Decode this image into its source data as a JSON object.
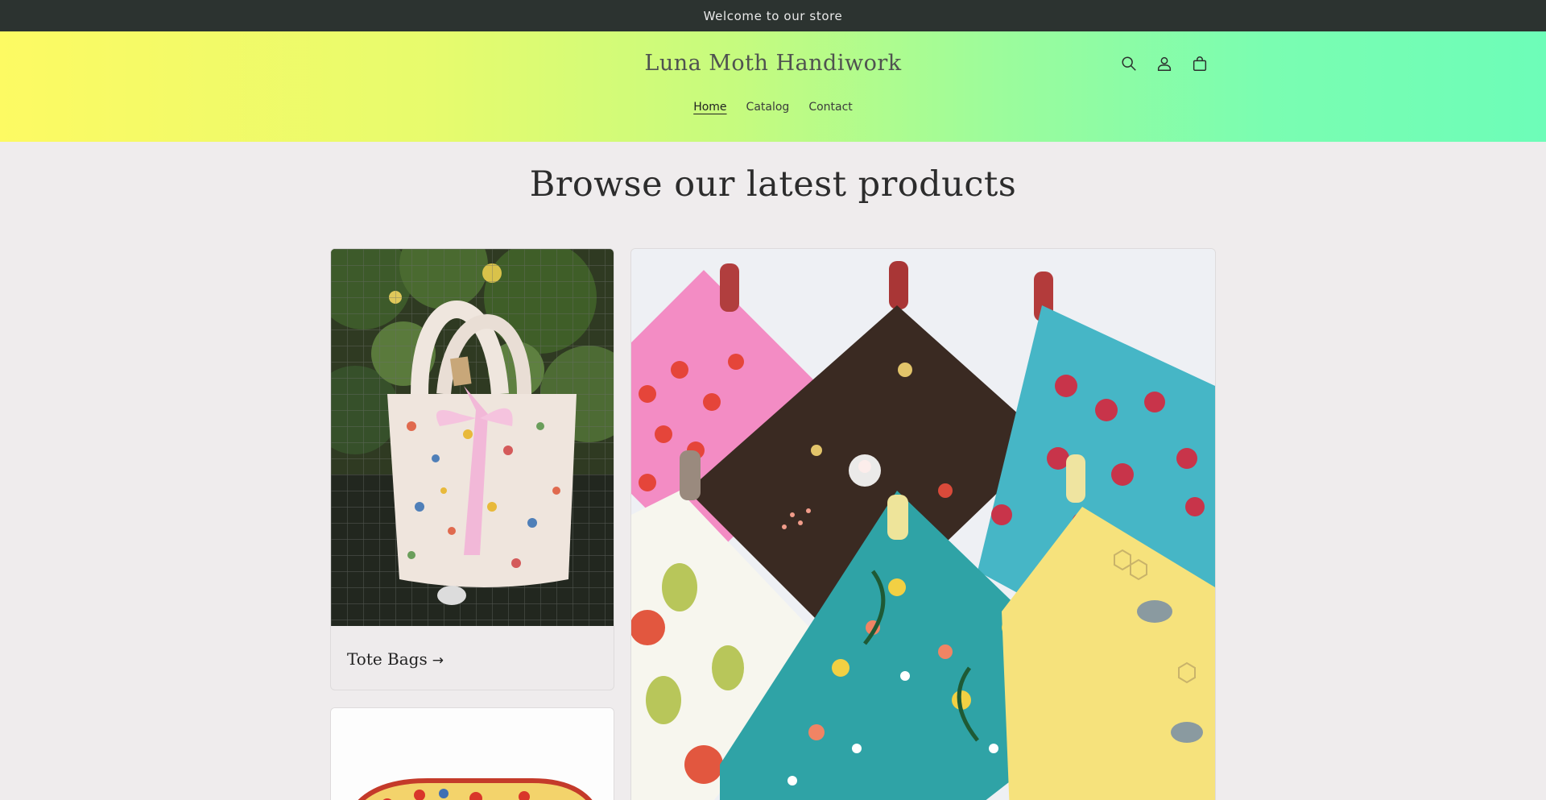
{
  "announcement": {
    "text": "Welcome to our store"
  },
  "header": {
    "brand": "Luna Moth Handiwork",
    "icons": [
      "search-icon",
      "account-icon",
      "cart-icon"
    ],
    "nav": [
      {
        "label": "Home",
        "active": true
      },
      {
        "label": "Catalog",
        "active": false
      },
      {
        "label": "Contact",
        "active": false
      }
    ]
  },
  "main": {
    "title": "Browse our latest products",
    "collections": [
      {
        "title": "Tote Bags",
        "image": "floral tote bag hanging on wire fence"
      },
      {
        "title": "",
        "image": "quilted pot holders in fruit and flower prints"
      },
      {
        "title": "",
        "image": "strawberry print pouch"
      }
    ]
  },
  "colors": {
    "announcement_bg": "#2c3330",
    "header_gradient_start": "#fdfa63",
    "header_gradient_end": "#6dfdb8",
    "page_bg": "#efeced"
  }
}
